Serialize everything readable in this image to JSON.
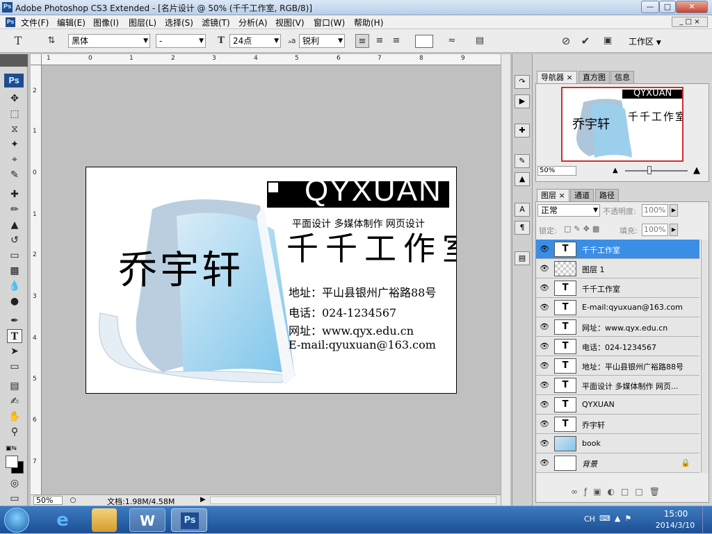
{
  "window": {
    "title": "Adobe Photoshop CS3 Extended - [名片设计 @ 50% (千千工作室, RGB/8)]",
    "app_icon": "Ps"
  },
  "menu": [
    "文件(F)",
    "编辑(E)",
    "图像(I)",
    "图层(L)",
    "选择(S)",
    "滤镜(T)",
    "分析(A)",
    "视图(V)",
    "窗口(W)",
    "帮助(H)"
  ],
  "options": {
    "font_family": "黑体",
    "font_style": "-",
    "font_size": "24点",
    "aa_label": "ₐa",
    "antialias": "锐利",
    "workspace": "工作区"
  },
  "ruler": {
    "top": [
      "1",
      "0",
      "1",
      "2",
      "3",
      "4",
      "5",
      "6",
      "7",
      "8",
      "9"
    ],
    "left": [
      "2",
      "1",
      "0",
      "1",
      "2",
      "3",
      "4",
      "5",
      "6",
      "7"
    ]
  },
  "doc_canvas": {
    "brand": "QYXUAN",
    "tagline": "平面设计 多媒体制作 网页设计",
    "studio": "千千工作室",
    "logo_text": "乔宇轩",
    "address": "地址：平山县银州广裕路88号",
    "phone": "电话：024-1234567",
    "website": "网址：www.qyx.edu.cn",
    "email": "E-mail:qyuxuan@163.com"
  },
  "status": {
    "zoom": "50%",
    "doc_info": "文档:1.98M/4.58M"
  },
  "navigator": {
    "tabs": [
      "导航器",
      "直方图",
      "信息"
    ],
    "zoom": "50%",
    "thumb_brand": "QYXUAN",
    "thumb_studio": "千千工作室",
    "thumb_logo": "乔宇轩"
  },
  "layers_panel": {
    "tabs": [
      "图层",
      "通道",
      "路径"
    ],
    "blend_mode": "正常",
    "opacity_label": "不透明度:",
    "opacity": "100%",
    "lock_label": "锁定:",
    "fill_label": "填充:",
    "fill": "100%",
    "layers": [
      {
        "name": "千千工作室",
        "type": "text",
        "selected": true
      },
      {
        "name": "图层 1",
        "type": "raster"
      },
      {
        "name": "千千工作室",
        "type": "text"
      },
      {
        "name": "E-mail:qyuxuan@163.com",
        "type": "text"
      },
      {
        "name": "网址：www.qyx.edu.cn",
        "type": "text"
      },
      {
        "name": "电话：024-1234567",
        "type": "text"
      },
      {
        "name": "地址：平山县银州广裕路88号",
        "type": "text"
      },
      {
        "name": "平面设计 多媒体制作 网页...",
        "type": "text"
      },
      {
        "name": "QYXUAN",
        "type": "text"
      },
      {
        "name": "乔宇轩",
        "type": "text"
      },
      {
        "name": "book",
        "type": "smart"
      },
      {
        "name": "背景",
        "type": "background"
      }
    ]
  },
  "taskbar": {
    "lang": "CH",
    "time": "15:00",
    "date": "2014/3/10",
    "ps_label": "Ps"
  },
  "colors": {
    "layer_selected": "#3a8ee6",
    "book_blue": "#9ccfec"
  }
}
